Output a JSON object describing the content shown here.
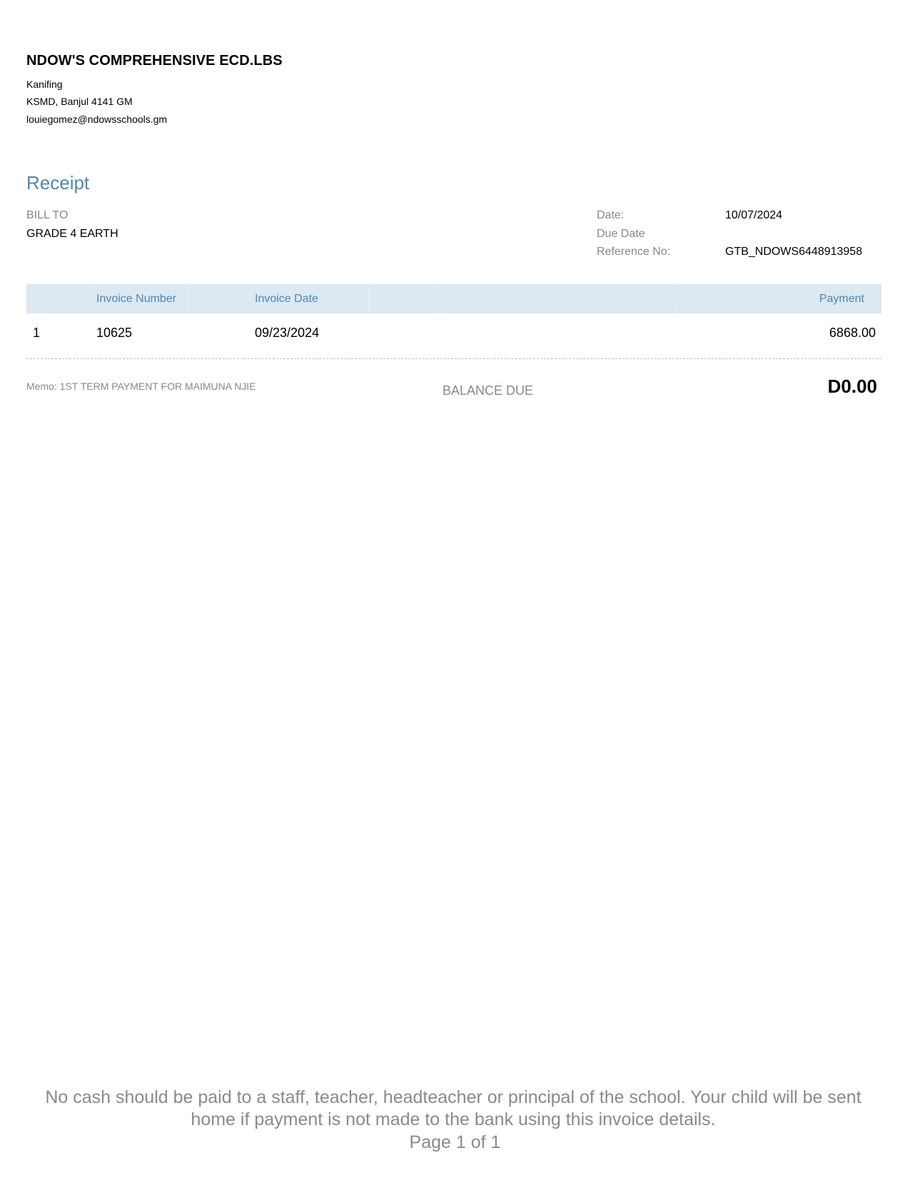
{
  "company": {
    "name": "NDOW'S COMPREHENSIVE ECD.LBS",
    "address_line1": "Kanifing",
    "address_line2": "KSMD, Banjul  4141 GM",
    "email": "louiegomez@ndowsschools.gm"
  },
  "document": {
    "title": "Receipt"
  },
  "bill_to": {
    "label": "BILL TO",
    "value": "GRADE 4 EARTH"
  },
  "meta": {
    "date_label": "Date:",
    "date_value": "10/07/2024",
    "due_label": "Due Date",
    "due_value": "",
    "ref_label": "Reference No:",
    "ref_value": "GTB_NDOWS6448913958"
  },
  "table": {
    "headers": {
      "invoice_number": "Invoice Number",
      "invoice_date": "Invoice Date",
      "payment": "Payment"
    },
    "rows": [
      {
        "index": "1",
        "invoice_number": "10625",
        "invoice_date": "09/23/2024",
        "payment": "6868.00"
      }
    ]
  },
  "summary": {
    "memo": "Memo: 1ST TERM PAYMENT FOR MAIMUNA NJIE",
    "balance_label": "BALANCE DUE",
    "balance_value": "D0.00"
  },
  "footer": {
    "note": "No cash should be paid to a staff, teacher, headteacher or principal of the school. Your child will be sent home if payment is not made to the bank using this invoice details.",
    "page": "Page 1 of 1"
  }
}
